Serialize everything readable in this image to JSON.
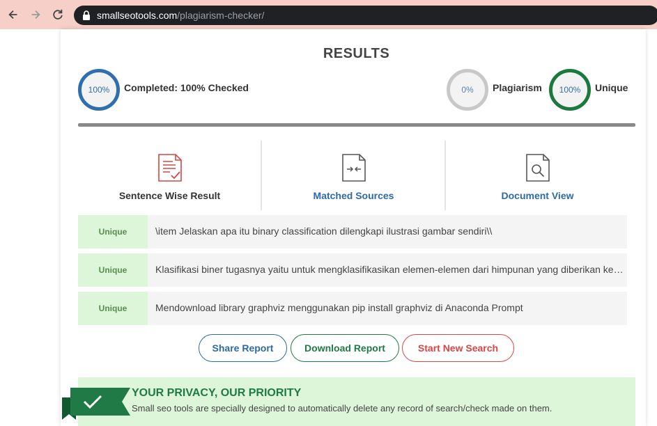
{
  "browser": {
    "url_domain": "smallseotools.com",
    "url_path": "/plagiarism-checker/"
  },
  "results": {
    "title": "RESULTS",
    "completed_percent": "100%",
    "completed_label": "Completed: 100% Checked",
    "plagiarism_percent": "0%",
    "plagiarism_label": "Plagiarism",
    "unique_percent": "100%",
    "unique_label": "Unique",
    "progress_fraction": 1.0
  },
  "tabs": [
    {
      "label": "Sentence Wise Result",
      "icon": "report-check-icon",
      "color": "#333333"
    },
    {
      "label": "Matched Sources",
      "icon": "document-compare-icon",
      "color": "#2c6aa5"
    },
    {
      "label": "Document View",
      "icon": "document-search-icon",
      "color": "#2c6aa5"
    }
  ],
  "sentences": [
    {
      "status": "Unique",
      "text": "\\item Jelaskan apa itu binary classification dilengkapi ilustrasi gambar sendiri\\\\"
    },
    {
      "status": "Unique",
      "text": "Klasifikasi biner tugasnya yaitu untuk mengklasifikasikan elemen-elemen dari himpunan yang diberikan ke dalam dua kelompok"
    },
    {
      "status": "Unique",
      "text": "Mendownload library graphviz menggunakan pip install graphviz di Anaconda Prompt"
    }
  ],
  "buttons": {
    "share": "Share Report",
    "download": "Download Report",
    "new_search": "Start New Search"
  },
  "privacy": {
    "title": "YOUR PRIVACY, OUR PRIORITY",
    "text": "Small seo tools are specially designed to automatically delete any record of search/check made on them."
  },
  "colors": {
    "brand_green": "#1f7a45",
    "brand_blue": "#2c6aa5",
    "danger_red": "#d94545",
    "unique_bg": "#ddf5d8"
  }
}
